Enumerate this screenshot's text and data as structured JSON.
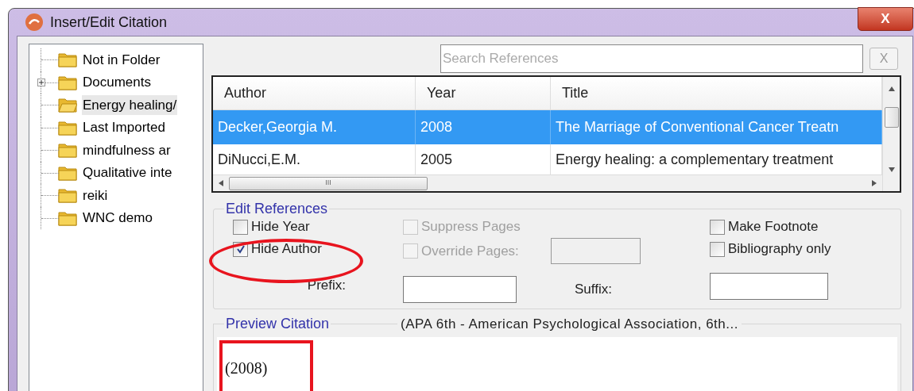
{
  "window": {
    "title": "Insert/Edit Citation",
    "close": "X"
  },
  "folders": [
    {
      "name": "Not in Folder",
      "selected": false
    },
    {
      "name": "Documents",
      "selected": false,
      "expanded": false
    },
    {
      "name": "Energy healing/",
      "selected": true
    },
    {
      "name": "Last Imported",
      "selected": false
    },
    {
      "name": "mindfulness ar",
      "selected": false
    },
    {
      "name": "Qualitative inte",
      "selected": false
    },
    {
      "name": "reiki",
      "selected": false
    },
    {
      "name": "WNC demo",
      "selected": false
    }
  ],
  "search": {
    "placeholder": "Search References",
    "clear": "X"
  },
  "table": {
    "columns": [
      "Author",
      "Year",
      "Title"
    ],
    "rows": [
      {
        "cells": [
          "Decker,Georgia M.",
          "2008",
          "The Marriage of Conventional Cancer Treatn"
        ],
        "selected": true
      },
      {
        "cells": [
          "DiNucci,E.M.",
          "2005",
          "Energy healing: a complementary treatment"
        ],
        "selected": false
      }
    ],
    "scroll_grip": "III"
  },
  "edit_references": {
    "title": "Edit References",
    "options": [
      {
        "label": "Hide Year",
        "checked": false,
        "disabled": false
      },
      {
        "label": "Hide Author",
        "checked": true,
        "disabled": false
      },
      {
        "label": "Suppress Pages",
        "checked": false,
        "disabled": true
      },
      {
        "label": "Override Pages:",
        "checked": false,
        "disabled": true
      },
      {
        "label": "Make Footnote",
        "checked": false,
        "disabled": false
      },
      {
        "label": "Bibliography only",
        "checked": false,
        "disabled": false
      }
    ],
    "prefix": {
      "label": "Prefix:"
    },
    "suffix": {
      "label": "Suffix:"
    }
  },
  "preview": {
    "title": "Preview Citation",
    "style": "(APA 6th - American Psychological Association, 6th...",
    "text": "(2008)"
  }
}
